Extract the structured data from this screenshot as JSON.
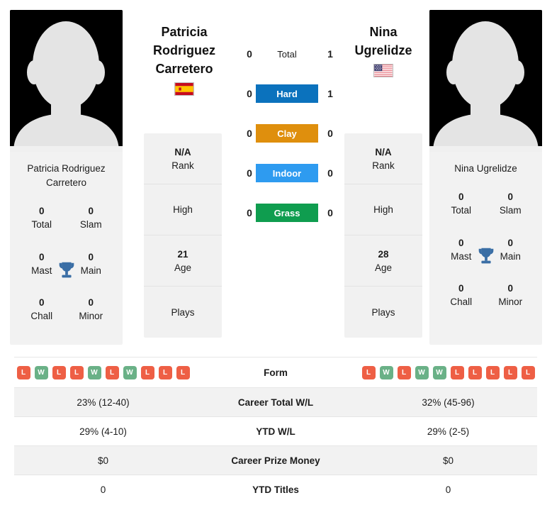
{
  "players": [
    {
      "side": "left",
      "display_name_lines": [
        "Patricia",
        "Rodriguez",
        "Carretero"
      ],
      "card_name": "Patricia Rodriguez Carretero",
      "country": "Spain",
      "flag": "es",
      "titles": [
        {
          "value": "0",
          "label": "Total"
        },
        {
          "value": "0",
          "label": "Slam"
        },
        {
          "value": "0",
          "label": "Mast"
        },
        {
          "value": "0",
          "label": "Main"
        },
        {
          "value": "0",
          "label": "Chall"
        },
        {
          "value": "0",
          "label": "Minor"
        }
      ],
      "info": [
        {
          "value": "N/A",
          "label": "Rank"
        },
        {
          "value": "",
          "label": "High"
        },
        {
          "value": "21",
          "label": "Age"
        },
        {
          "value": "",
          "label": "Plays"
        }
      ],
      "form": [
        "L",
        "W",
        "L",
        "L",
        "W",
        "L",
        "W",
        "L",
        "L",
        "L"
      ],
      "stats": {
        "career_wl": "23% (12-40)",
        "ytd_wl": "29% (4-10)",
        "career_prize_money": "$0",
        "ytd_titles": "0"
      }
    },
    {
      "side": "right",
      "display_name_lines": [
        "Nina",
        "Ugrelidze"
      ],
      "card_name": "Nina Ugrelidze",
      "country": "United States",
      "flag": "us",
      "titles": [
        {
          "value": "0",
          "label": "Total"
        },
        {
          "value": "0",
          "label": "Slam"
        },
        {
          "value": "0",
          "label": "Mast"
        },
        {
          "value": "0",
          "label": "Main"
        },
        {
          "value": "0",
          "label": "Chall"
        },
        {
          "value": "0",
          "label": "Minor"
        }
      ],
      "info": [
        {
          "value": "N/A",
          "label": "Rank"
        },
        {
          "value": "",
          "label": "High"
        },
        {
          "value": "28",
          "label": "Age"
        },
        {
          "value": "",
          "label": "Plays"
        }
      ],
      "form": [
        "L",
        "W",
        "L",
        "W",
        "W",
        "L",
        "L",
        "L",
        "L",
        "L"
      ],
      "stats": {
        "career_wl": "32% (45-96)",
        "ytd_wl": "29% (2-5)",
        "career_prize_money": "$0",
        "ytd_titles": "0"
      }
    }
  ],
  "head_to_head": [
    {
      "surface": "Total",
      "left": "0",
      "right": "1",
      "color": "transparent",
      "text_color": "#1c1c1c"
    },
    {
      "surface": "Hard",
      "left": "0",
      "right": "1",
      "color": "#0b72bd",
      "text_color": "#ffffff"
    },
    {
      "surface": "Clay",
      "left": "0",
      "right": "0",
      "color": "#df8f0d",
      "text_color": "#ffffff"
    },
    {
      "surface": "Indoor",
      "left": "0",
      "right": "0",
      "color": "#2e9bf0",
      "text_color": "#ffffff"
    },
    {
      "surface": "Grass",
      "left": "0",
      "right": "0",
      "color": "#0f9d4f",
      "text_color": "#ffffff"
    }
  ],
  "stats_table": {
    "form_label": "Form",
    "rows": [
      {
        "label": "Career Total W/L",
        "left": "23% (12-40)",
        "right": "32% (45-96)"
      },
      {
        "label": "YTD W/L",
        "left": "29% (4-10)",
        "right": "29% (2-5)"
      },
      {
        "label": "Career Prize Money",
        "left": "$0",
        "right": "$0"
      },
      {
        "label": "YTD Titles",
        "left": "0",
        "right": "0"
      }
    ]
  },
  "colors": {
    "win_badge": "#6ab187",
    "loss_badge": "#ee5f45",
    "hard": "#0b72bd",
    "clay": "#df8f0d",
    "indoor": "#2e9bf0",
    "grass": "#0f9d4f",
    "trophy": "#3a6ea5",
    "card_bg": "#f2f2f2"
  }
}
